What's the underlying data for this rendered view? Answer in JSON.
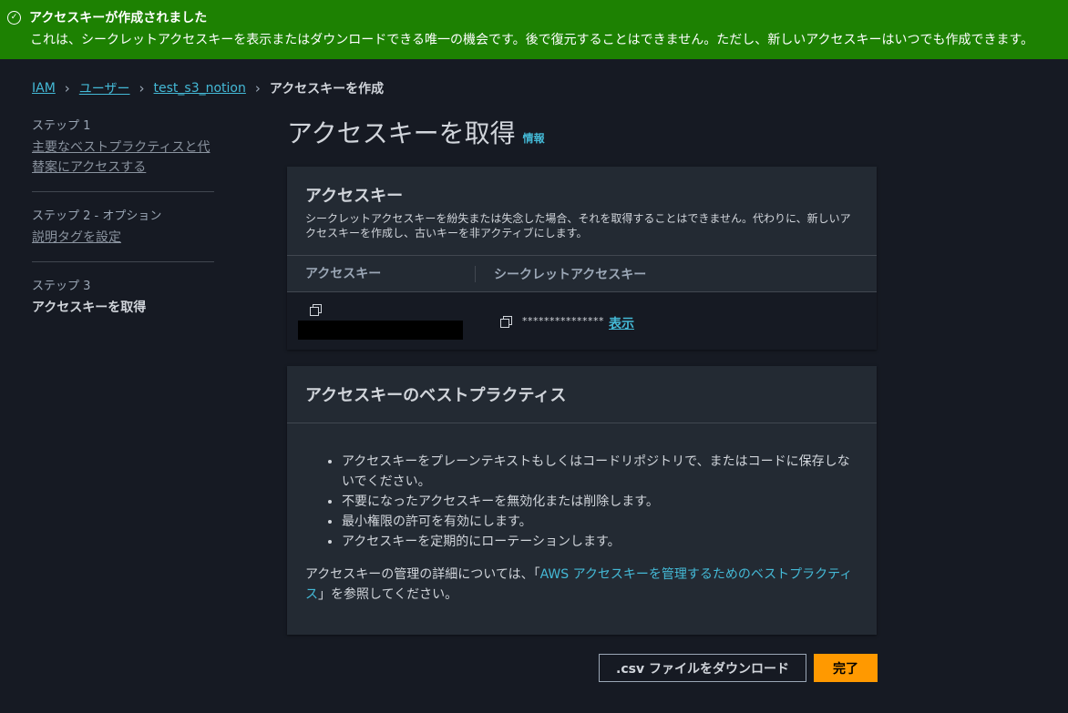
{
  "banner": {
    "title": "アクセスキーが作成されました",
    "message": "これは、シークレットアクセスキーを表示またはダウンロードできる唯一の機会です。後で復元することはできません。ただし、新しいアクセスキーはいつでも作成できます。",
    "icon": "check-circle-icon",
    "color": "#1d8102"
  },
  "breadcrumb": {
    "items": [
      "IAM",
      "ユーザー",
      "test_s3_notion"
    ],
    "current": "アクセスキーを作成"
  },
  "steps": [
    {
      "num": "ステップ 1",
      "label": "主要なベストプラクティスと代替案にアクセスする"
    },
    {
      "num": "ステップ 2 - オプション",
      "label": "説明タグを設定"
    },
    {
      "num": "ステップ 3",
      "label": "アクセスキーを取得"
    }
  ],
  "page": {
    "title": "アクセスキーを取得",
    "info": "情報"
  },
  "access_key_panel": {
    "title": "アクセスキー",
    "description": "シークレットアクセスキーを紛失または失念した場合、それを取得することはできません。代わりに、新しいアクセスキーを作成し、古いキーを非アクティブにします。",
    "col_access_key": "アクセスキー",
    "col_secret_key": "シークレットアクセスキー",
    "secret_masked": "***************",
    "show_link": "表示"
  },
  "best_practices": {
    "title": "アクセスキーのベストプラクティス",
    "items": [
      "アクセスキーをプレーンテキストもしくはコードリポジトリで、またはコードに保存しないでください。",
      "不要になったアクセスキーを無効化または削除します。",
      "最小権限の許可を有効にします。",
      "アクセスキーを定期的にローテーションします。"
    ],
    "ref_prefix": "アクセスキーの管理の詳細については、「",
    "ref_link": "AWS アクセスキーを管理するためのベストプラクティス",
    "ref_suffix": "」を参照してください。"
  },
  "actions": {
    "download": ".csv ファイルをダウンロード",
    "done": "完了",
    "primary_color": "#ff9900"
  }
}
